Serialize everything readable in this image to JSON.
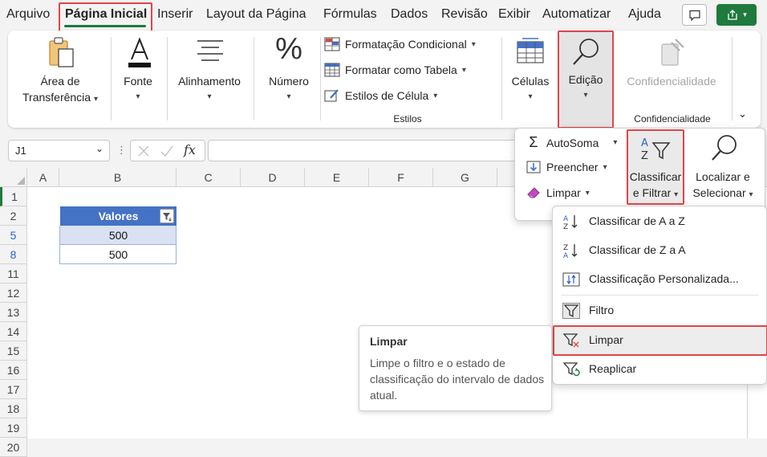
{
  "menubar": {
    "tabs": [
      "Arquivo",
      "Página Inicial",
      "Inserir",
      "Layout da Página",
      "Fórmulas",
      "Dados",
      "Revisão",
      "Exibir",
      "Automatizar",
      "Ajuda"
    ],
    "active_tab": "Página Inicial"
  },
  "ribbon": {
    "clipboard": {
      "line1": "Área de",
      "line2": "Transferência"
    },
    "font": "Fonte",
    "alignment": "Alinhamento",
    "number": "Número",
    "styles": {
      "conditional": "Formatação Condicional",
      "as_table": "Formatar como Tabela",
      "cell_styles": "Estilos de Célula",
      "group_label": "Estilos"
    },
    "cells": "Células",
    "editing": "Edição",
    "sensitivity": {
      "button": "Confidencialidade",
      "group_label": "Confidencialidade"
    }
  },
  "formula_bar": {
    "name_box": "J1",
    "fx": "fx",
    "value": ""
  },
  "grid": {
    "columns": [
      "A",
      "B",
      "C",
      "D",
      "E",
      "F",
      "G"
    ],
    "rows": [
      "1",
      "2",
      "5",
      "8",
      "11",
      "12",
      "13",
      "14",
      "15",
      "16",
      "17",
      "18",
      "19",
      "20"
    ],
    "header_cell": "Valores",
    "values": [
      "500",
      "500"
    ]
  },
  "editing_panel": {
    "autosum": "AutoSoma",
    "fill": "Preencher",
    "clear": "Limpar",
    "sort_filter": {
      "line1": "Classificar",
      "line2": "e Filtrar"
    },
    "find_select": {
      "line1": "Localizar e",
      "line2": "Selecionar"
    }
  },
  "sort_menu": {
    "items": [
      "Classificar de A a Z",
      "Classificar de Z a A",
      "Classificação Personalizada...",
      "Filtro",
      "Limpar",
      "Reaplicar"
    ]
  },
  "tooltip": {
    "title": "Limpar",
    "body": "Limpe o filtro e o estado de classificação do intervalo de dados atual."
  },
  "colors": {
    "accent_green": "#1f7a3e",
    "highlight_red": "#e0454a",
    "table_header_blue": "#4472c4",
    "table_band": "#d9e1f2",
    "filtered_row_blue": "#2f5fd0"
  }
}
